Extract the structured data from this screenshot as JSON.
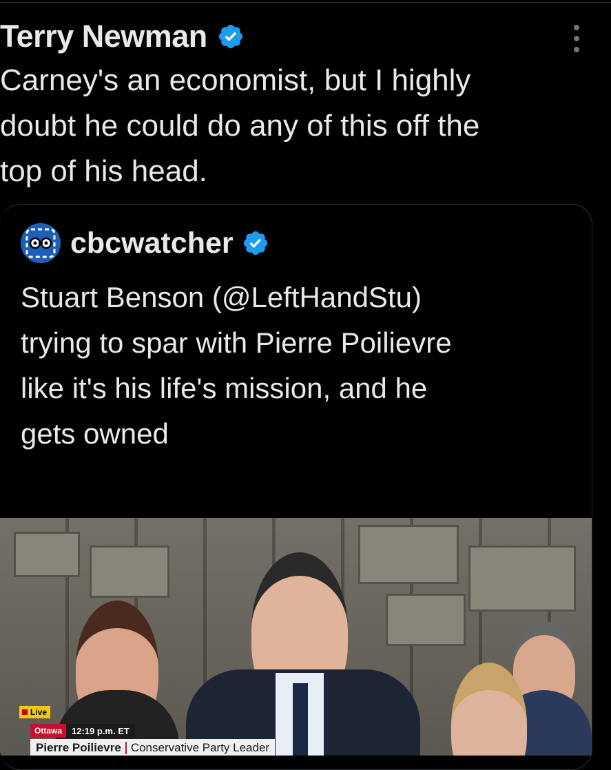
{
  "tweet": {
    "author": "Terry Newman",
    "text": "Carney's an economist, but I highly\ndoubt he could do any of this off the\ntop of his head."
  },
  "quote": {
    "author": "cbcwatcher",
    "text": "Stuart Benson (@LeftHandStu)\ntrying to spar with Pierre Poilievre\nlike it's his life's mission, and he\ngets owned",
    "more": "..."
  },
  "video": {
    "live_label": "Live",
    "location": "Ottawa",
    "time": "12:19 p.m. ET",
    "person_name": "Pierre Poilievre",
    "person_title": "Conservative Party Leader"
  },
  "colors": {
    "background": "#000000",
    "text": "#e7e9ea",
    "verified": "#1d9bf0",
    "border": "#2f3336"
  },
  "icons": {
    "verified": "verified-badge-icon",
    "more": "more-vertical-icon",
    "avatar": "cbcwatcher-avatar"
  }
}
